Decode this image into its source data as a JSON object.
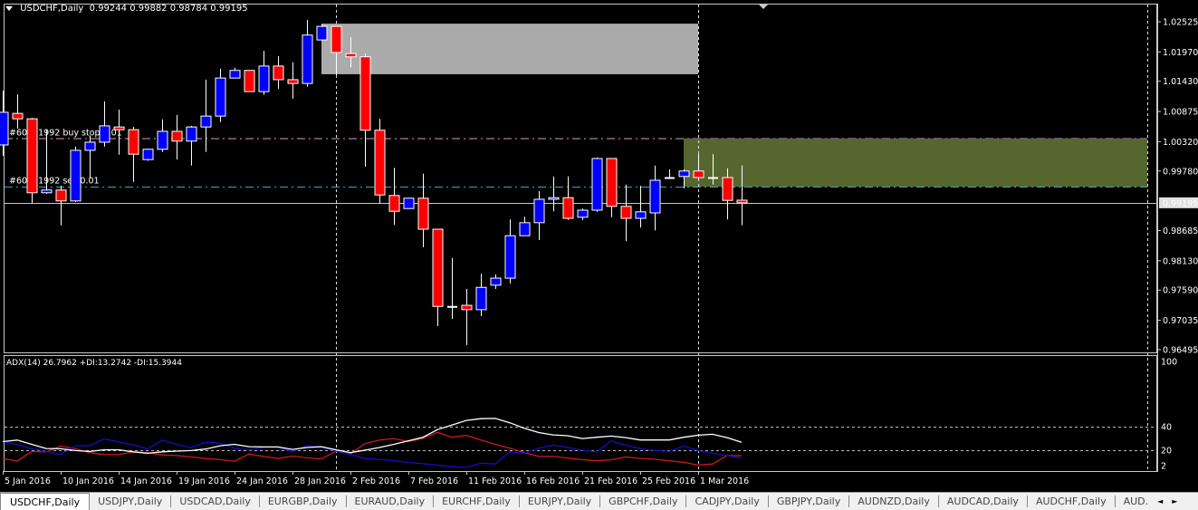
{
  "header": {
    "symbol": "USDCHF,Daily",
    "ohlc": "0.99244 0.99882 0.98784 0.99195"
  },
  "indicator": {
    "label": "ADX(14) 26.7962 +DI:13.2742 -DI:15.3944",
    "levels": [
      "100",
      "40",
      "20",
      "2"
    ]
  },
  "colors": {
    "bull": "#0000ff",
    "bear": "#ff0000",
    "wick": "#ffffff",
    "adx": "#ffffff",
    "plus_di": "#1010c8",
    "minus_di": "#d01818",
    "gray_zone": "#ababab",
    "green_zone": "#55672f",
    "background": "#000000"
  },
  "orders": [
    {
      "label": "#602  1992 buy stop 0.01",
      "price": 1.0038,
      "type": "buy stop"
    },
    {
      "label": "#602  1992 sell 0.01",
      "price": 0.9949,
      "type": "sell"
    }
  ],
  "current_price": "0.99195",
  "price_axis": [
    "1.02525",
    "1.01970",
    "1.01430",
    "1.00875",
    "1.00320",
    "0.99780",
    "0.98685",
    "0.98130",
    "0.97590",
    "0.97035",
    "0.96495"
  ],
  "date_labels": [
    {
      "label": "5 Jan 2016",
      "bar": 0
    },
    {
      "label": "10 Jan 2016",
      "bar": 4
    },
    {
      "label": "14 Jan 2016",
      "bar": 8
    },
    {
      "label": "19 Jan 2016",
      "bar": 12
    },
    {
      "label": "24 Jan 2016",
      "bar": 16
    },
    {
      "label": "28 Jan 2016",
      "bar": 20
    },
    {
      "label": "2 Feb 2016",
      "bar": 24
    },
    {
      "label": "7 Feb 2016",
      "bar": 28
    },
    {
      "label": "11 Feb 2016",
      "bar": 32
    },
    {
      "label": "16 Feb 2016",
      "bar": 36
    },
    {
      "label": "21 Feb 2016",
      "bar": 40
    },
    {
      "label": "25 Feb 2016",
      "bar": 44
    },
    {
      "label": "1 Mar 2016",
      "bar": 48
    }
  ],
  "period_separators": [
    23,
    48
  ],
  "zones": [
    {
      "name": "gray",
      "from_bar": 22,
      "to_bar": 48,
      "high": 1.0249,
      "low": 1.0156
    },
    {
      "name": "green",
      "from_bar": 47,
      "to_bar": 79,
      "high": 1.0038,
      "low": 0.9949
    }
  ],
  "candles": [
    [
      1.0026,
      1.0126,
      1.0006,
      1.0086
    ],
    [
      1.0084,
      1.0119,
      1.0056,
      1.0074
    ],
    [
      1.0074,
      1.0076,
      0.9919,
      0.9938
    ],
    [
      0.9938,
      1.0054,
      0.9936,
      0.9943
    ],
    [
      0.9943,
      0.9951,
      0.9878,
      0.9923
    ],
    [
      0.9923,
      1.0023,
      0.9921,
      1.0016
    ],
    [
      1.0016,
      1.0043,
      0.9964,
      1.0031
    ],
    [
      1.0031,
      1.0106,
      1.0023,
      1.0061
    ],
    [
      1.0059,
      1.0091,
      1.0008,
      1.0054
    ],
    [
      1.0054,
      1.0059,
      0.9958,
      1.0009
    ],
    [
      0.9999,
      1.0019,
      0.9997,
      1.0018
    ],
    [
      1.0018,
      1.0073,
      1.0013,
      1.0051
    ],
    [
      1.0051,
      1.0081,
      0.9999,
      1.0033
    ],
    [
      1.0033,
      1.0061,
      0.9988,
      1.0059
    ],
    [
      1.0059,
      1.0146,
      1.0013,
      1.0079
    ],
    [
      1.0079,
      1.0166,
      1.0068,
      1.0149
    ],
    [
      1.0149,
      1.0168,
      1.0149,
      1.0163
    ],
    [
      1.0163,
      1.0163,
      1.0124,
      1.0124
    ],
    [
      1.0124,
      1.0199,
      1.0118,
      1.0171
    ],
    [
      1.0171,
      1.0189,
      1.0129,
      1.0146
    ],
    [
      1.0146,
      1.0178,
      1.0111,
      1.0139
    ],
    [
      1.0139,
      1.0256,
      1.0133,
      1.0228
    ],
    [
      1.0219,
      1.0248,
      1.0218,
      1.0244
    ],
    [
      1.0244,
      1.0244,
      1.0154,
      1.0196
    ],
    [
      1.0194,
      1.0224,
      1.0169,
      1.0188
    ],
    [
      1.0188,
      1.0194,
      0.9986,
      1.0053
    ],
    [
      1.0053,
      1.0074,
      0.9919,
      0.9934
    ],
    [
      0.9933,
      0.9984,
      0.9879,
      0.9904
    ],
    [
      0.9909,
      0.9929,
      0.9909,
      0.9928
    ],
    [
      0.9928,
      0.9973,
      0.9838,
      0.9871
    ],
    [
      0.9871,
      0.9871,
      0.9693,
      0.9729
    ],
    [
      0.9729,
      0.9818,
      0.9706,
      0.9729
    ],
    [
      0.9731,
      0.9761,
      0.9658,
      0.9723
    ],
    [
      0.9723,
      0.9789,
      0.9711,
      0.9764
    ],
    [
      0.9768,
      0.9788,
      0.9761,
      0.9781
    ],
    [
      0.9781,
      0.9889,
      0.9771,
      0.9859
    ],
    [
      0.9859,
      0.9894,
      0.9859,
      0.9883
    ],
    [
      0.9883,
      0.9941,
      0.9851,
      0.9926
    ],
    [
      0.9926,
      0.9968,
      0.9904,
      0.9929
    ],
    [
      0.9929,
      0.9968,
      0.9888,
      0.9891
    ],
    [
      0.9893,
      0.9909,
      0.9888,
      0.9906
    ],
    [
      0.9906,
      1.0003,
      0.9903,
      1.0001
    ],
    [
      1.0001,
      1.0001,
      0.9893,
      0.9913
    ],
    [
      0.9913,
      0.9953,
      0.9849,
      0.9891
    ],
    [
      0.9891,
      0.9951,
      0.9874,
      0.9903
    ],
    [
      0.9901,
      0.9988,
      0.9869,
      0.9961
    ],
    [
      0.9966,
      0.9981,
      0.9963,
      0.9966
    ],
    [
      0.9968,
      0.9981,
      0.9946,
      0.9978
    ],
    [
      0.9978,
      1.0009,
      0.9961,
      0.9966
    ],
    [
      0.9966,
      1.0009,
      0.9953,
      0.9966
    ],
    [
      0.9966,
      0.9983,
      0.9889,
      0.9924
    ],
    [
      0.99244,
      0.99882,
      0.98784,
      0.99195
    ]
  ],
  "adx": {
    "adx": [
      27.3,
      28.6,
      25,
      21.5,
      21.2,
      19.7,
      18.9,
      20.4,
      20.4,
      18.6,
      17.4,
      18.6,
      19.2,
      19.7,
      21,
      23.8,
      25,
      23,
      22.8,
      22.8,
      20.7,
      22.3,
      23,
      20.4,
      17.9,
      20,
      22.3,
      25,
      28,
      31,
      37.5,
      41.3,
      45.3,
      46.8,
      47,
      43.3,
      38.7,
      35,
      33,
      32.3,
      29.9,
      31,
      32,
      30.7,
      28.7,
      28.7,
      28.7,
      31,
      32.8,
      33.5,
      30.7,
      26.8
    ],
    "plus_di": [
      27.3,
      24.8,
      21.2,
      18.9,
      16.4,
      23.5,
      24,
      29.6,
      27,
      24.6,
      21.2,
      28.6,
      25,
      22.3,
      26.7,
      26,
      21.8,
      20,
      22.6,
      22.6,
      18.9,
      24,
      22.6,
      19.2,
      16.3,
      12.9,
      12.2,
      11,
      9.6,
      8.5,
      7.4,
      6,
      5.4,
      9,
      8.3,
      18.7,
      17.4,
      21.8,
      24.3,
      22.3,
      20,
      18.5,
      28,
      24.3,
      21.5,
      19.7,
      18.9,
      23.5,
      19.7,
      17.4,
      15.5,
      13.3
    ],
    "minus_di": [
      12.9,
      10.8,
      18.9,
      18.5,
      23.5,
      21.2,
      17.9,
      16.4,
      16.2,
      18.5,
      17.9,
      16,
      15.5,
      14.3,
      13,
      12,
      10.6,
      16.8,
      14.7,
      13,
      15,
      13.5,
      12.6,
      19.2,
      16.8,
      25.5,
      28.6,
      29.9,
      27.3,
      30,
      35.2,
      31,
      32.6,
      28.6,
      25,
      21.8,
      18,
      14.7,
      14.7,
      13.4,
      11.9,
      11,
      11.9,
      14.3,
      13,
      12.3,
      11,
      9.8,
      7.4,
      8.3,
      15.5,
      15.4
    ]
  },
  "tabs": [
    {
      "label": "USDCHF,Daily",
      "active": true
    },
    {
      "label": "USDJPY,Daily"
    },
    {
      "label": "USDCAD,Daily"
    },
    {
      "label": "EURGBP,Daily"
    },
    {
      "label": "EURAUD,Daily"
    },
    {
      "label": "EURCHF,Daily"
    },
    {
      "label": "EURJPY,Daily"
    },
    {
      "label": "GBPCHF,Daily"
    },
    {
      "label": "CADJPY,Daily"
    },
    {
      "label": "GBPJPY,Daily"
    },
    {
      "label": "AUDNZD,Daily"
    },
    {
      "label": "AUDCAD,Daily"
    },
    {
      "label": "AUDCHF,Daily"
    },
    {
      "label": "AUD."
    }
  ],
  "tab_scroll": {
    "left": "◄",
    "right": "►"
  }
}
